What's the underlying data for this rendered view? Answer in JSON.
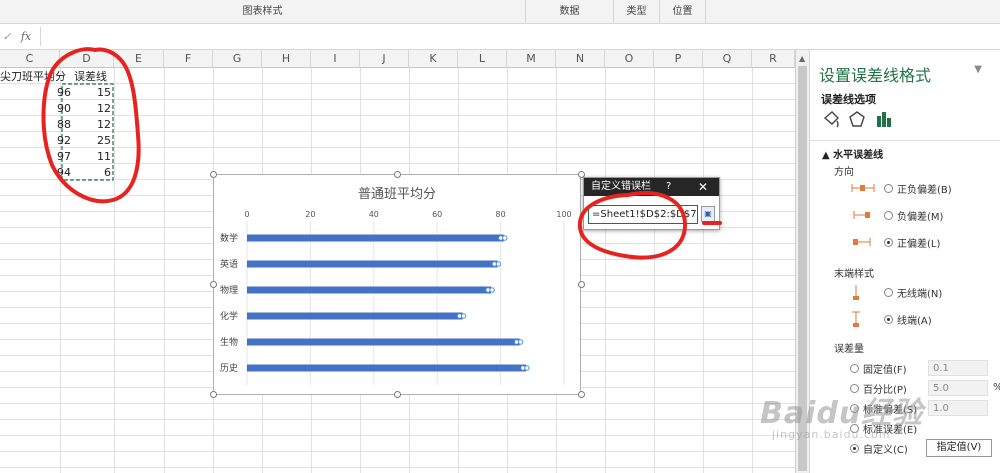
{
  "ribbon": {
    "groups": [
      "图表样式",
      "数据",
      "类型",
      "位置"
    ],
    "formula_cancel": "✓",
    "fx_label": "fx"
  },
  "sheet": {
    "columns": [
      "C",
      "D",
      "E",
      "F",
      "G",
      "H",
      "I",
      "J",
      "K",
      "L",
      "M",
      "N",
      "O",
      "P",
      "Q",
      "R"
    ],
    "header_c": "尖刀班平均分",
    "header_d": "误差线",
    "col_c": [
      "96",
      "90",
      "88",
      "92",
      "97",
      "94"
    ],
    "col_d": [
      "15",
      "12",
      "12",
      "25",
      "11",
      "6"
    ]
  },
  "chart": {
    "chart_data": {
      "type": "bar",
      "title": "普通班平均分",
      "categories": [
        "数学",
        "英语",
        "物理",
        "化学",
        "生物",
        "历史"
      ],
      "values": [
        81,
        79,
        77,
        68,
        86,
        88
      ],
      "xlim": [
        0,
        100
      ],
      "x_ticks": [
        "0",
        "20",
        "40",
        "60",
        "80",
        "100"
      ],
      "bar_color": "#4472c4",
      "orientation": "horizontal"
    }
  },
  "dialog": {
    "title": "自定义错误栏",
    "help": "?",
    "close": "✕",
    "input_value": "=Sheet1!$D$2:$D$7"
  },
  "pane": {
    "title": "设置误差线格式",
    "subtitle": "误差线选项",
    "section": "水平误差线",
    "direction_label": "方向",
    "directions": [
      "正负偏差(B)",
      "负偏差(M)",
      "正偏差(L)"
    ],
    "endstyle_label": "末端样式",
    "endstyles": [
      "无线端(N)",
      "线端(A)"
    ],
    "amount_label": "误差量",
    "fixed_label": "固定值(F)",
    "fixed_value": "0.1",
    "percent_label": "百分比(P)",
    "percent_value": "5.0",
    "percent_unit": "%",
    "stddev_label": "标准偏差(S)",
    "stddev_value": "1.0",
    "stderr_label": "标准误差(E)",
    "custom_label": "自定义(C)",
    "specify_button": "指定值(V)"
  },
  "watermark": {
    "main": "Baidu经验",
    "sub": "jingyan.baidu.com"
  }
}
